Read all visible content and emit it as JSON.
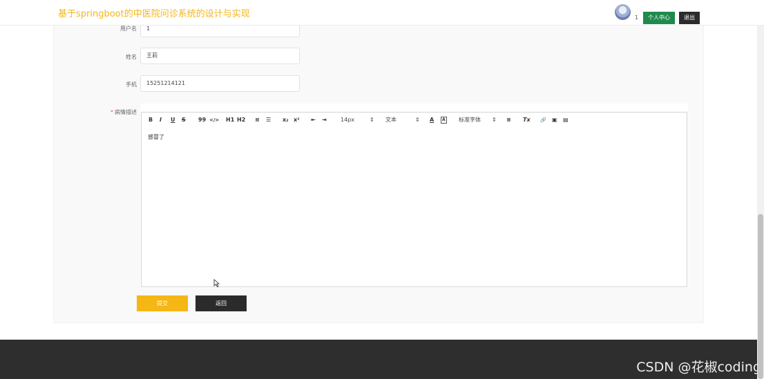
{
  "header": {
    "site_title": "基于springboot的中医院问诊系统的设计与实现",
    "user_number": "1",
    "personal_center_label": "个人中心",
    "logout_label": "退出"
  },
  "form": {
    "username": {
      "label": "用户名",
      "value": "1"
    },
    "name": {
      "label": "姓名",
      "value": "王莉"
    },
    "phone": {
      "label": "手机",
      "value": "15251214121"
    },
    "description": {
      "required_mark": "*",
      "label": "病情描述",
      "content": "感冒了"
    }
  },
  "toolbar": {
    "bold": "B",
    "italic": "I",
    "underline": "U",
    "strike": "S",
    "quote": "99",
    "code": "</>",
    "h1": "H1",
    "h2": "H2",
    "ordered_list": "≡",
    "bullet_list": "☰",
    "subscript": "x₂",
    "superscript": "x²",
    "outdent": "⇤",
    "indent": "⇥",
    "font_size": "14px",
    "text_style": "文本",
    "font_family": "标准字体",
    "font_color": "A",
    "background_color": "A",
    "align": "≡",
    "clear_format": "Tx",
    "link": "🔗",
    "image": "▣",
    "video": "▤"
  },
  "actions": {
    "submit_label": "提交",
    "back_label": "返回"
  },
  "watermark": "CSDN @花椒coding",
  "colors": {
    "accent": "#f5b616",
    "green": "#1f8a4c",
    "dark": "#2b2b2b",
    "footer": "#2e2e2e"
  }
}
